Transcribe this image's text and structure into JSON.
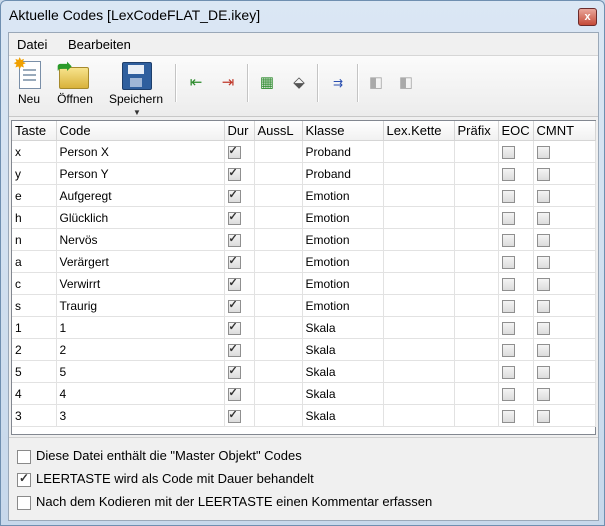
{
  "window": {
    "title": "Aktuelle Codes [LexCodeFLAT_DE.ikey]",
    "close_glyph": "x"
  },
  "menu": [
    "Datei",
    "Bearbeiten"
  ],
  "toolbar": {
    "new_label": "Neu",
    "open_label": "Öffnen",
    "save_label": "Speichern",
    "icons": [
      "insert-row-icon",
      "delete-row-icon",
      "export-icon",
      "eraser-icon",
      "column-arrows-icon",
      "disabled-copy-icon",
      "disabled-paste-icon"
    ]
  },
  "table": {
    "columns": [
      "Taste",
      "Code",
      "Dur",
      "AussL",
      "Klasse",
      "Lex.Kette",
      "Präfix",
      "EOC",
      "CMNT"
    ],
    "rows": [
      {
        "taste": "x",
        "code": "Person X",
        "dur": true,
        "klasse": "Proband"
      },
      {
        "taste": "y",
        "code": "Person Y",
        "dur": true,
        "klasse": "Proband"
      },
      {
        "taste": "e",
        "code": "Aufgeregt",
        "dur": true,
        "klasse": "Emotion"
      },
      {
        "taste": "h",
        "code": "Glücklich",
        "dur": true,
        "klasse": "Emotion"
      },
      {
        "taste": "n",
        "code": "Nervös",
        "dur": true,
        "klasse": "Emotion"
      },
      {
        "taste": "a",
        "code": "Verärgert",
        "dur": true,
        "klasse": "Emotion"
      },
      {
        "taste": "c",
        "code": "Verwirrt",
        "dur": true,
        "klasse": "Emotion"
      },
      {
        "taste": "s",
        "code": "Traurig",
        "dur": true,
        "klasse": "Emotion"
      },
      {
        "taste": "1",
        "code": "1",
        "dur": true,
        "klasse": "Skala"
      },
      {
        "taste": "2",
        "code": "2",
        "dur": true,
        "klasse": "Skala"
      },
      {
        "taste": "5",
        "code": "5",
        "dur": true,
        "klasse": "Skala"
      },
      {
        "taste": "4",
        "code": "4",
        "dur": true,
        "klasse": "Skala"
      },
      {
        "taste": "3",
        "code": "3",
        "dur": true,
        "klasse": "Skala"
      }
    ]
  },
  "options": [
    {
      "label": "Diese Datei enthält die \"Master Objekt\" Codes",
      "checked": false
    },
    {
      "label": "LEERTASTE wird als Code mit Dauer behandelt",
      "checked": true
    },
    {
      "label": "Nach dem Kodieren mit der LEERTASTE einen Kommentar erfassen",
      "checked": false
    }
  ]
}
